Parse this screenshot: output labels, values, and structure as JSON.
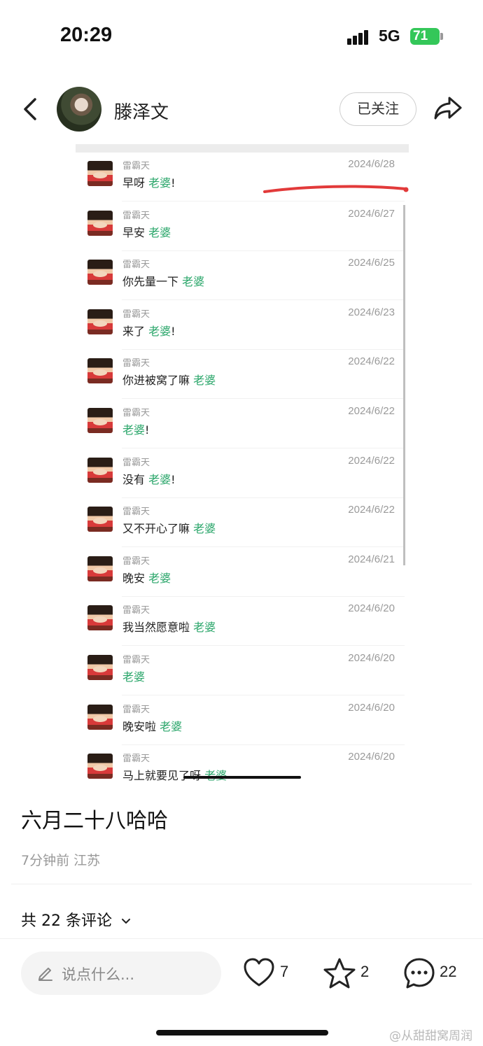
{
  "status_bar": {
    "time": "20:29",
    "network": "5G",
    "battery": "71"
  },
  "header": {
    "author_name": "滕泽文",
    "follow_label": "已关注"
  },
  "post_image": {
    "comments": [
      {
        "user": "雷霸天",
        "date": "2024/6/28",
        "text": "早呀",
        "keyword": "老婆",
        "suffix": "!"
      },
      {
        "user": "雷霸天",
        "date": "2024/6/27",
        "text": "早安",
        "keyword": "老婆",
        "suffix": ""
      },
      {
        "user": "雷霸天",
        "date": "2024/6/25",
        "text": "你先量一下",
        "keyword": "老婆",
        "suffix": ""
      },
      {
        "user": "雷霸天",
        "date": "2024/6/23",
        "text": "来了",
        "keyword": "老婆",
        "suffix": "!"
      },
      {
        "user": "雷霸天",
        "date": "2024/6/22",
        "text": "你进被窝了嘛",
        "keyword": "老婆",
        "suffix": ""
      },
      {
        "user": "雷霸天",
        "date": "2024/6/22",
        "text": "",
        "keyword": "老婆",
        "suffix": "!"
      },
      {
        "user": "雷霸天",
        "date": "2024/6/22",
        "text": "没有",
        "keyword": "老婆",
        "suffix": "!"
      },
      {
        "user": "雷霸天",
        "date": "2024/6/22",
        "text": "又不开心了嘛",
        "keyword": "老婆",
        "suffix": ""
      },
      {
        "user": "雷霸天",
        "date": "2024/6/21",
        "text": "晚安",
        "keyword": "老婆",
        "suffix": ""
      },
      {
        "user": "雷霸天",
        "date": "2024/6/20",
        "text": "我当然愿意啦",
        "keyword": "老婆",
        "suffix": ""
      },
      {
        "user": "雷霸天",
        "date": "2024/6/20",
        "text": "",
        "keyword": "老婆",
        "suffix": ""
      },
      {
        "user": "雷霸天",
        "date": "2024/6/20",
        "text": "晚安啦",
        "keyword": "老婆",
        "suffix": ""
      },
      {
        "user": "雷霸天",
        "date": "2024/6/20",
        "text": "马上就要见了呀",
        "keyword": "老婆",
        "suffix": ""
      }
    ]
  },
  "post": {
    "caption": "六月二十八哈哈",
    "meta": "7分钟前 江苏",
    "comments_count_label": "共 22 条评论"
  },
  "bottom_bar": {
    "input_placeholder": "说点什么...",
    "likes": "7",
    "favorites": "2",
    "comments": "22"
  },
  "watermark": "@从甜甜窝周润",
  "colors": {
    "keyword_green": "#2aa66a",
    "annotation_red": "#e23a3a",
    "battery_green": "#34c759"
  },
  "icons": [
    "back-arrow-icon",
    "share-icon",
    "pen-icon",
    "heart-icon",
    "star-icon",
    "comment-bubble-icon",
    "chevron-down-icon"
  ]
}
